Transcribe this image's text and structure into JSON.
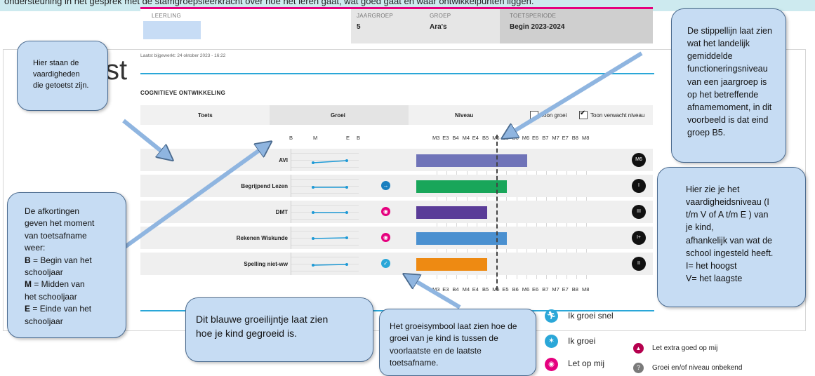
{
  "intro_text": "ondersteuning in het gesprek met de stamgroepsleerkracht over hoe het leren gaat, wat goed gaat en waar ontwikkelpunten liggen.",
  "page_title_fragment": "st",
  "header": {
    "leerling_label": "LEERLING",
    "jaargroep_label": "JAARGROEP",
    "jaargroep_value": "5",
    "groep_label": "GROEP",
    "groep_value": "Ara's",
    "toetsperiode_label": "TOETSPERIODE",
    "toetsperiode_value": "Begin 2023-2024"
  },
  "last_updated": "Laatst bijgewerkt: 24 oktober 2023 - 16:22",
  "section_title": "COGNITIEVE ONTWIKKELING",
  "columns": {
    "toets": "Toets",
    "groei": "Groei",
    "niveau": "Niveau",
    "toon_groei": "Toon groei",
    "toon_verwacht": "Toon verwacht niveau"
  },
  "growth_ticks": [
    "B",
    "M",
    "E",
    "B"
  ],
  "level_ticks": [
    "M3",
    "E3",
    "B4",
    "M4",
    "E4",
    "B5",
    "M5",
    "E5",
    "B6",
    "M6",
    "E6",
    "B7",
    "M7",
    "E7",
    "B8",
    "M8"
  ],
  "colors": {
    "accent_blue": "#2aa7d8",
    "pink": "#e5007e",
    "bubble": "#c6dcf3"
  },
  "rows": [
    {
      "name": "AVI",
      "bar_color": "#6f73b8",
      "level_end": "M6",
      "badge": "M6",
      "growth_icon": ""
    },
    {
      "name": "Begrijpend Lezen",
      "bar_color": "#19a65a",
      "level_end": "E5",
      "badge": "I",
      "growth_icon": "runner-icon"
    },
    {
      "name": "DMT",
      "bar_color": "#5a3c98",
      "level_end": "B5",
      "badge": "III",
      "growth_icon": "eye-icon"
    },
    {
      "name": "Rekenen Wiskunde",
      "bar_color": "#4a90d0",
      "level_end": "E5",
      "badge": "I+",
      "growth_icon": "eye-icon"
    },
    {
      "name": "Spelling niet-ww",
      "bar_color": "#ee8a12",
      "level_end": "B5",
      "badge": "II",
      "growth_icon": "sprout-icon"
    }
  ],
  "bubbles": {
    "skills": "Hier staan de\nvaardigheden\ndie getoetst zijn.",
    "dashed": "De stippellijn laat zien\nwat het landelijk\ngemiddelde\nfunctioneringsniveau\nvan een jaargroep is\nop het betreffende\nafnamemoment, in dit\nvoorbeeld is dat eind\ngroep B5.",
    "level": "Hier zie je het\nvaardigheidsniveau (I\nt/m V of A t/m E ) van\nje kind,\nafhankelijk van wat de\nschool ingesteld heeft.\nI= het hoogst\nV= het laagste",
    "abbrev_intro": "De afkortingen\ngeven het moment\nvan toetsafname\nweer:",
    "abbrev_b_key": "B",
    "abbrev_b": " = Begin van het\nschooljaar",
    "abbrev_m_key": "M",
    "abbrev_m": " = Midden van\nhet schooljaar",
    "abbrev_e_key": "E",
    "abbrev_e": " = Einde van het\nschooljaar",
    "growline": "Dit blauwe groeilijntje laat zien\nhoe je kind gegroeid is.",
    "symbol": "Het groeisymbool laat zien hoe de\ngroei van je kind is tussen de\nvoorlaatste en de laatste\ntoetsafname."
  },
  "legend": {
    "fast": "Ik groei snel",
    "grow": "Ik groei",
    "watch": "Let op mij",
    "extra": "Let extra goed op mij",
    "unknown": "Groei en/of niveau onbekend"
  }
}
